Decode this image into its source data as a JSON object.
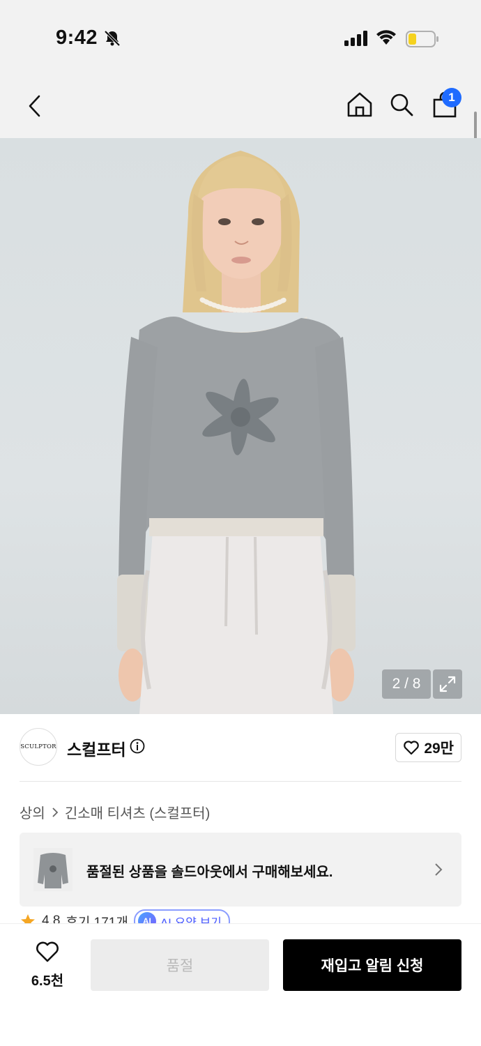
{
  "status": {
    "time": "9:42",
    "icons": [
      "bell-slash-icon",
      "cellular-signal-icon",
      "wifi-icon",
      "battery-low-icon"
    ]
  },
  "nav": {
    "icons": [
      "back-chevron-icon",
      "home-icon",
      "search-icon",
      "shopping-bag-icon"
    ],
    "cart_count": "1"
  },
  "gallery": {
    "counter": "2 / 8",
    "expand_icon": "expand-arrows-icon"
  },
  "brand": {
    "logo_text": "SCULPTOR",
    "name": "스컬프터",
    "likes": "29만"
  },
  "breadcrumb": {
    "category": "상의",
    "subcategory": "긴소매 티셔츠 (스컬프터)"
  },
  "soldout_banner": {
    "text": "품절된 상품을 솔드아웃에서 구매해보세요."
  },
  "rating": {
    "score": "4.8",
    "reviews": "후기 171개",
    "ai_badge": "AI",
    "ai_label": "AI 요약 보기"
  },
  "bottom": {
    "wish_count": "6.5천",
    "soldout_label": "품절",
    "restock_label": "재입고 알림 신청"
  },
  "colors": {
    "accent_blue": "#1f6bff",
    "primary_button": "#000000",
    "disabled_button": "#ececec"
  }
}
